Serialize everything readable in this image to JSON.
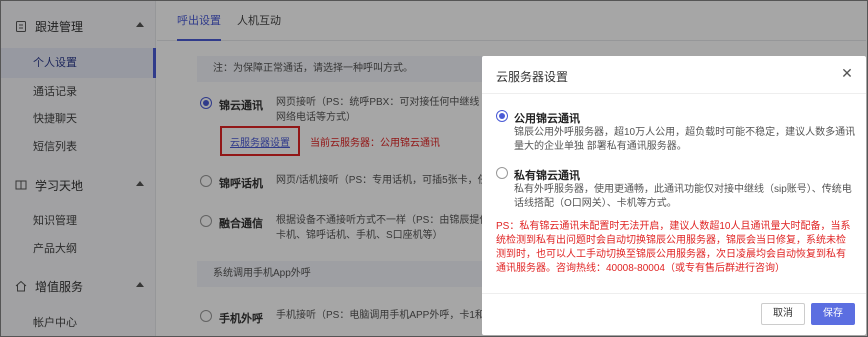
{
  "sidebar": {
    "groups": [
      {
        "label": "跟进管理",
        "icon": "clipboard-icon"
      },
      {
        "label": "学习天地",
        "icon": "book-icon"
      },
      {
        "label": "增值服务",
        "icon": "home-icon"
      }
    ],
    "items": [
      "个人设置",
      "通话记录",
      "快捷聊天",
      "短信列表",
      "知识管理",
      "产品大纲",
      "帐户中心"
    ],
    "active_item": "个人设置"
  },
  "tabs": [
    "呼出设置",
    "人机互动"
  ],
  "notice": "注：为保障正常通话，请选择一种呼叫方式。",
  "options": [
    {
      "label": "锦云通讯",
      "desc_line1": "网页接听（PS：统呼PBX：可对接任何中继线（",
      "desc_line2": "网络电话等方式）"
    },
    {
      "label": "锦呼话机",
      "desc_line1": "网页/话机接听（PS：专用话机，可插5张卡，任"
    },
    {
      "label": "融合通信",
      "desc_line1": "根据设备不通接听方式不一样（PS：由锦辰提供",
      "desc_line2": "卡机、锦呼话机、手机、S口座机等）"
    }
  ],
  "cloud_server_link": "云服务器设置",
  "current_server": "当前云服务器：公用锦云通讯",
  "section_mobile": "系统调用手机App外呼",
  "mobile_option": {
    "label": "手机外呼",
    "desc": "手机接听（PS：电脑调用手机APP外呼，卡1和"
  },
  "modal": {
    "title": "云服务器设置",
    "public": {
      "label": "公用锦云通讯",
      "desc1": "锦辰公用外呼服务器，超10万人公用，超负载时可能不稳定，建议人数多通讯",
      "desc2": "量大的企业单独 部署私有通讯服务器。"
    },
    "private": {
      "label": "私有锦云通讯",
      "desc1": "私有外呼服务器，使用更通畅，此通讯功能仅对接中继线（sip账号）、传统电",
      "desc2": "话线搭配（O口网关）、卡机等方式。"
    },
    "ps": "PS：私有锦云通讯未配置时无法开启，建议人数超10人且通讯量大时配备，当系统检测到私有出问题时会自动切换锦辰公用服务器，锦辰会当日修复，系统未检测到时，也可以人工手动切换至锦辰公用服务器，次日凌晨均会自动恢复到私有通讯服务器。咨询热线：40008-80004（或专有售后群进行咨询）",
    "cancel": "取消",
    "save": "保存"
  },
  "colors": {
    "accent": "#4a5bd6",
    "warning": "#e02424",
    "sidebar_bg": "#f7f8fa"
  }
}
